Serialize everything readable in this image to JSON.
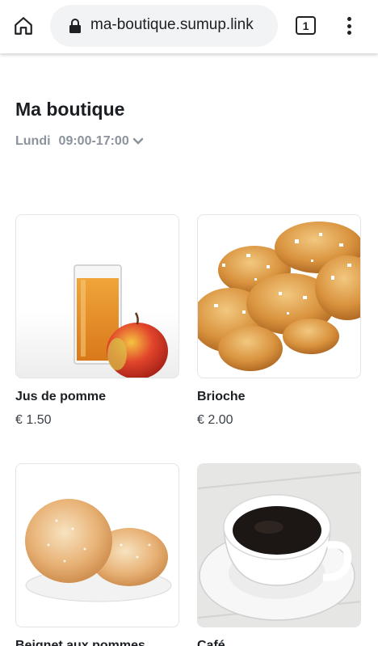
{
  "browser": {
    "url": "ma-boutique.sumup.link",
    "tab_count": "1"
  },
  "shop": {
    "title": "Ma boutique",
    "hours_day": "Lundi",
    "hours_time": "09:00-17:00"
  },
  "products": [
    {
      "name": "Jus de pomme",
      "price": "€ 1.50"
    },
    {
      "name": "Brioche",
      "price": "€ 2.00"
    },
    {
      "name": "Beignet aux pommes",
      "price": ""
    },
    {
      "name": "Café",
      "price": ""
    }
  ],
  "icons": {
    "home": "home-icon",
    "lock": "lock-icon",
    "menu": "more-vert-icon",
    "chevron": "chevron-down-icon"
  }
}
